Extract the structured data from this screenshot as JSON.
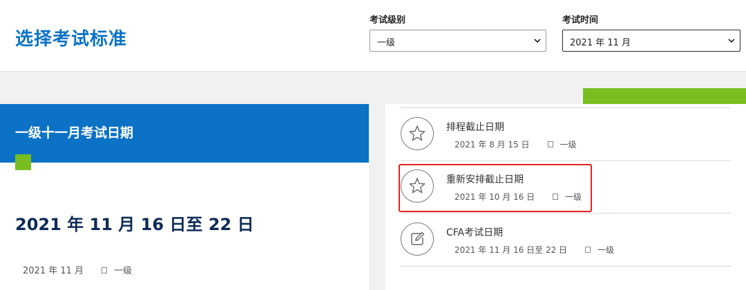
{
  "header": {
    "title": "选择考试标准",
    "level_filter": {
      "label": "考试级别",
      "value": "一级"
    },
    "time_filter": {
      "label": "考试时间",
      "value": "2021 年 11 月"
    }
  },
  "left_card": {
    "band_title": "一级十一月考试日期",
    "big_date": "2021 年 11 月 16 日至 22 日",
    "meta_date": "2021 年 11 月",
    "meta_level": "一级"
  },
  "schedule_items": [
    {
      "title": "排程截止日期",
      "date": "2021 年 8 月 15 日",
      "level": "一级",
      "icon": "star-icon"
    },
    {
      "title": "重新安排截止日期",
      "date": "2021 年 10 月 16 日",
      "level": "一级",
      "icon": "star-icon",
      "highlighted": true
    },
    {
      "title": "CFA考试日期",
      "date": "2021 年 11 月 16 日至 22 日",
      "level": "一级",
      "icon": "edit-icon"
    }
  ],
  "colors": {
    "brand_blue": "#0b72c5",
    "accent_green": "#78be20",
    "highlight_red": "#e02020",
    "navy": "#0e2a56"
  }
}
